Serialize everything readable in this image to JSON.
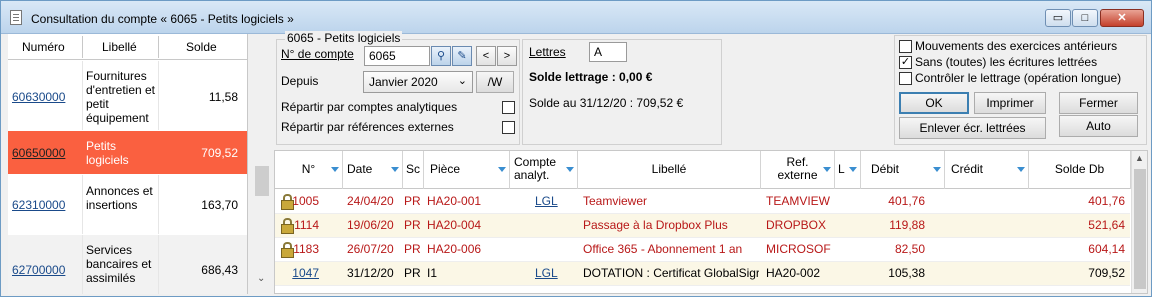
{
  "window": {
    "title": "Consultation du compte « 6065 - Petits logiciels »",
    "min_glyph": "▭",
    "max_glyph": "□",
    "close_glyph": "✕"
  },
  "left_list": {
    "headers": [
      "Numéro",
      "Libellé",
      "Solde"
    ],
    "rows": [
      {
        "numero": "60630000",
        "libelle": "Fournitures d'entretien et petit équipement",
        "solde": "11,58"
      },
      {
        "numero": "60650000",
        "libelle": "Petits logiciels",
        "solde": "709,52",
        "selected": true
      },
      {
        "numero": "62310000",
        "libelle": "Annonces et insertions",
        "solde": "163,70"
      },
      {
        "numero": "62700000",
        "libelle": "Services bancaires et assimilés",
        "solde": "686,43"
      }
    ],
    "scroll_down_glyph": "⌄"
  },
  "form": {
    "group_title": "6065 - Petits logiciels",
    "compte_label": "N° de compte",
    "compte_value": "6065",
    "prev_glyph": "<",
    "next_glyph": ">",
    "depuis_label": "Depuis",
    "depuis_value": "Janvier 2020",
    "mw_label": "/W",
    "repartir_analytiques": "Répartir par comptes analytiques",
    "repartir_externes": "Répartir par références externes"
  },
  "lettres": {
    "label": "Lettres",
    "value": "A",
    "solde_lettrage": "Solde lettrage : 0,00 €",
    "solde_au": "Solde au 31/12/20 : 709,52 €"
  },
  "options": {
    "mouvements": "Mouvements des exercices antérieurs",
    "sans_ecritures": "Sans (toutes) les écritures lettrées",
    "controler": "Contrôler le lettrage (opération longue)",
    "check_glyph": "✓"
  },
  "buttons": {
    "ok": "OK",
    "imprimer": "Imprimer",
    "fermer": "Fermer",
    "enlever": "Enlever écr. lettrées",
    "auto": "Auto"
  },
  "grid": {
    "headers": {
      "n": "N°",
      "date": "Date",
      "sc": "Sc",
      "piece": "Pièce",
      "compte1": "Compte",
      "compte2": "analyt.",
      "libelle": "Libellé",
      "ref1": "Ref.",
      "ref2": "externe",
      "l": "L",
      "debit": "Débit",
      "credit": "Crédit",
      "solde": "Solde Db"
    },
    "rows": [
      {
        "n": "1005",
        "date": "24/04/20",
        "sc": "PR",
        "piece": "HA20-001",
        "compte": "LGL",
        "libelle": "Teamviewer",
        "ref": "TEAMVIEW",
        "l": "",
        "debit": "401,76",
        "credit": "",
        "solde": "401,76",
        "locked": true,
        "red": true
      },
      {
        "n": "1114",
        "date": "19/06/20",
        "sc": "PR",
        "piece": "HA20-004",
        "compte": "",
        "libelle": "Passage à la Dropbox Plus",
        "ref": "DROPBOX",
        "l": "",
        "debit": "119,88",
        "credit": "",
        "solde": "521,64",
        "locked": true,
        "red": true
      },
      {
        "n": "1183",
        "date": "26/07/20",
        "sc": "PR",
        "piece": "HA20-006",
        "compte": "",
        "libelle": "Office 365 - Abonnement 1 an",
        "ref": "MICROSOF",
        "l": "",
        "debit": "82,50",
        "credit": "",
        "solde": "604,14",
        "locked": true,
        "red": true
      },
      {
        "n": "1047",
        "date": "31/12/20",
        "sc": "PR",
        "piece": "I1",
        "compte": "LGL",
        "libelle": "DOTATION : Certificat GlobalSigr",
        "ref": "HA20-002",
        "l": "",
        "debit": "105,38",
        "credit": "",
        "solde": "709,52",
        "locked": false,
        "red": false
      }
    ],
    "scroll_up_glyph": "▲"
  }
}
